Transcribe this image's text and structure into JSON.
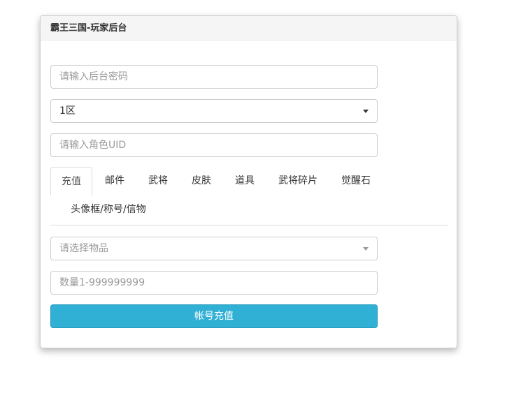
{
  "panel": {
    "title": "霸王三国-玩家后台"
  },
  "form": {
    "password_placeholder": "请输入后台密码",
    "server_value": "1区",
    "uid_placeholder": "请输入角色UID",
    "item_placeholder": "请选择物品",
    "quantity_placeholder": "数量1-999999999",
    "submit_label": "帐号充值"
  },
  "tabs": [
    {
      "label": "充值",
      "active": true
    },
    {
      "label": "邮件",
      "active": false
    },
    {
      "label": "武将",
      "active": false
    },
    {
      "label": "皮肤",
      "active": false
    },
    {
      "label": "道具",
      "active": false
    },
    {
      "label": "武将碎片",
      "active": false
    },
    {
      "label": "觉醒石",
      "active": false
    },
    {
      "label": "头像框/称号/信物",
      "active": false
    }
  ],
  "colors": {
    "accent": "#31b0d5",
    "heading_bg": "#f5f5f5"
  }
}
